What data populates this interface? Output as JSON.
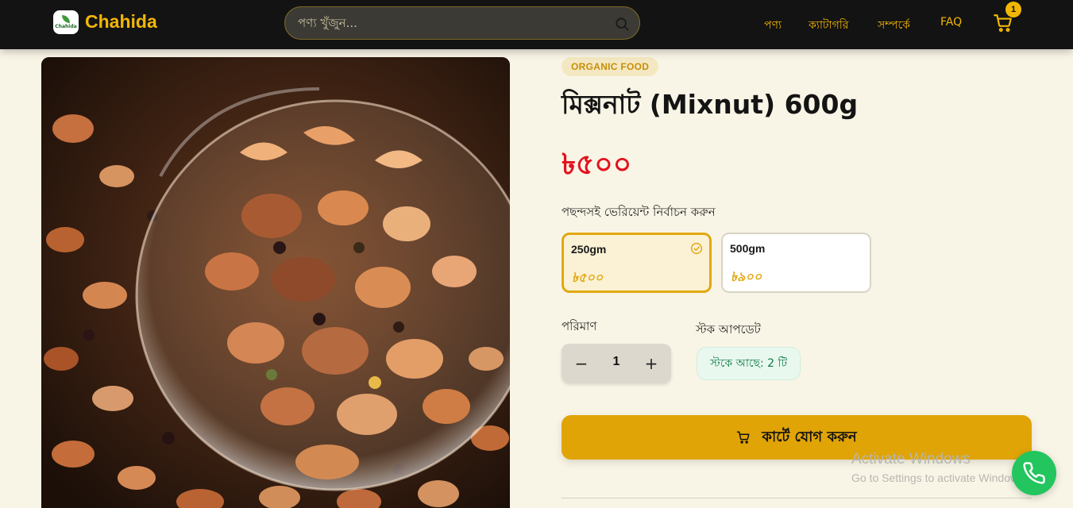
{
  "header": {
    "brand": "Chahida",
    "logo_mini_text": "Chahida",
    "search_placeholder": "পণ্য খুঁজুন...",
    "nav": [
      "পণ্য",
      "ক্যাটাগরি",
      "সম্পর্কে",
      "FAQ"
    ],
    "cart_count": "1"
  },
  "product": {
    "tag": "ORGANIC FOOD",
    "title": "মিক্সনাট (Mixnut) 600g",
    "price": "৳৫০০",
    "variant_label": "পছন্দসই ভেরিয়েন্ট নির্বাচন করুন",
    "variants": [
      {
        "name": "250gm",
        "price": "৳৫০০",
        "selected": true
      },
      {
        "name": "500gm",
        "price": "৳৯০০",
        "selected": false
      }
    ],
    "quantity_label": "পরিমাণ",
    "quantity": "1",
    "minus_symbol": "−",
    "plus_symbol": "+",
    "stock_label": "স্টক আপডেট",
    "stock_text": "স্টকে আছে: 2 টি",
    "add_to_cart": "কার্টে যোগ করুন"
  },
  "watermark": {
    "line1": "Activate Windows",
    "line2": "Go to Settings to activate Windows."
  },
  "colors": {
    "accent": "#e0a406",
    "price": "#e3121e",
    "header_bg": "#131313",
    "page_bg": "#f9f5e6",
    "stock_green": "#0f7a45",
    "fab_green": "#22c55e"
  },
  "icons": [
    "search-icon",
    "cart-icon",
    "check-circle-icon",
    "phone-icon"
  ]
}
